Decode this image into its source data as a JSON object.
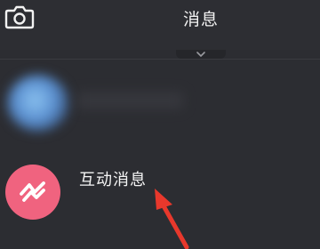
{
  "header": {
    "title": "消息",
    "camera_icon": "camera-icon"
  },
  "pull_tab": {
    "icon": "chevron-down-icon"
  },
  "messages": [
    {
      "label": "互动消息",
      "icon": "interaction-icon",
      "avatar_color": "#f0637f"
    }
  ],
  "colors": {
    "background": "#2c2d32",
    "annotation_arrow": "#e8382c"
  }
}
